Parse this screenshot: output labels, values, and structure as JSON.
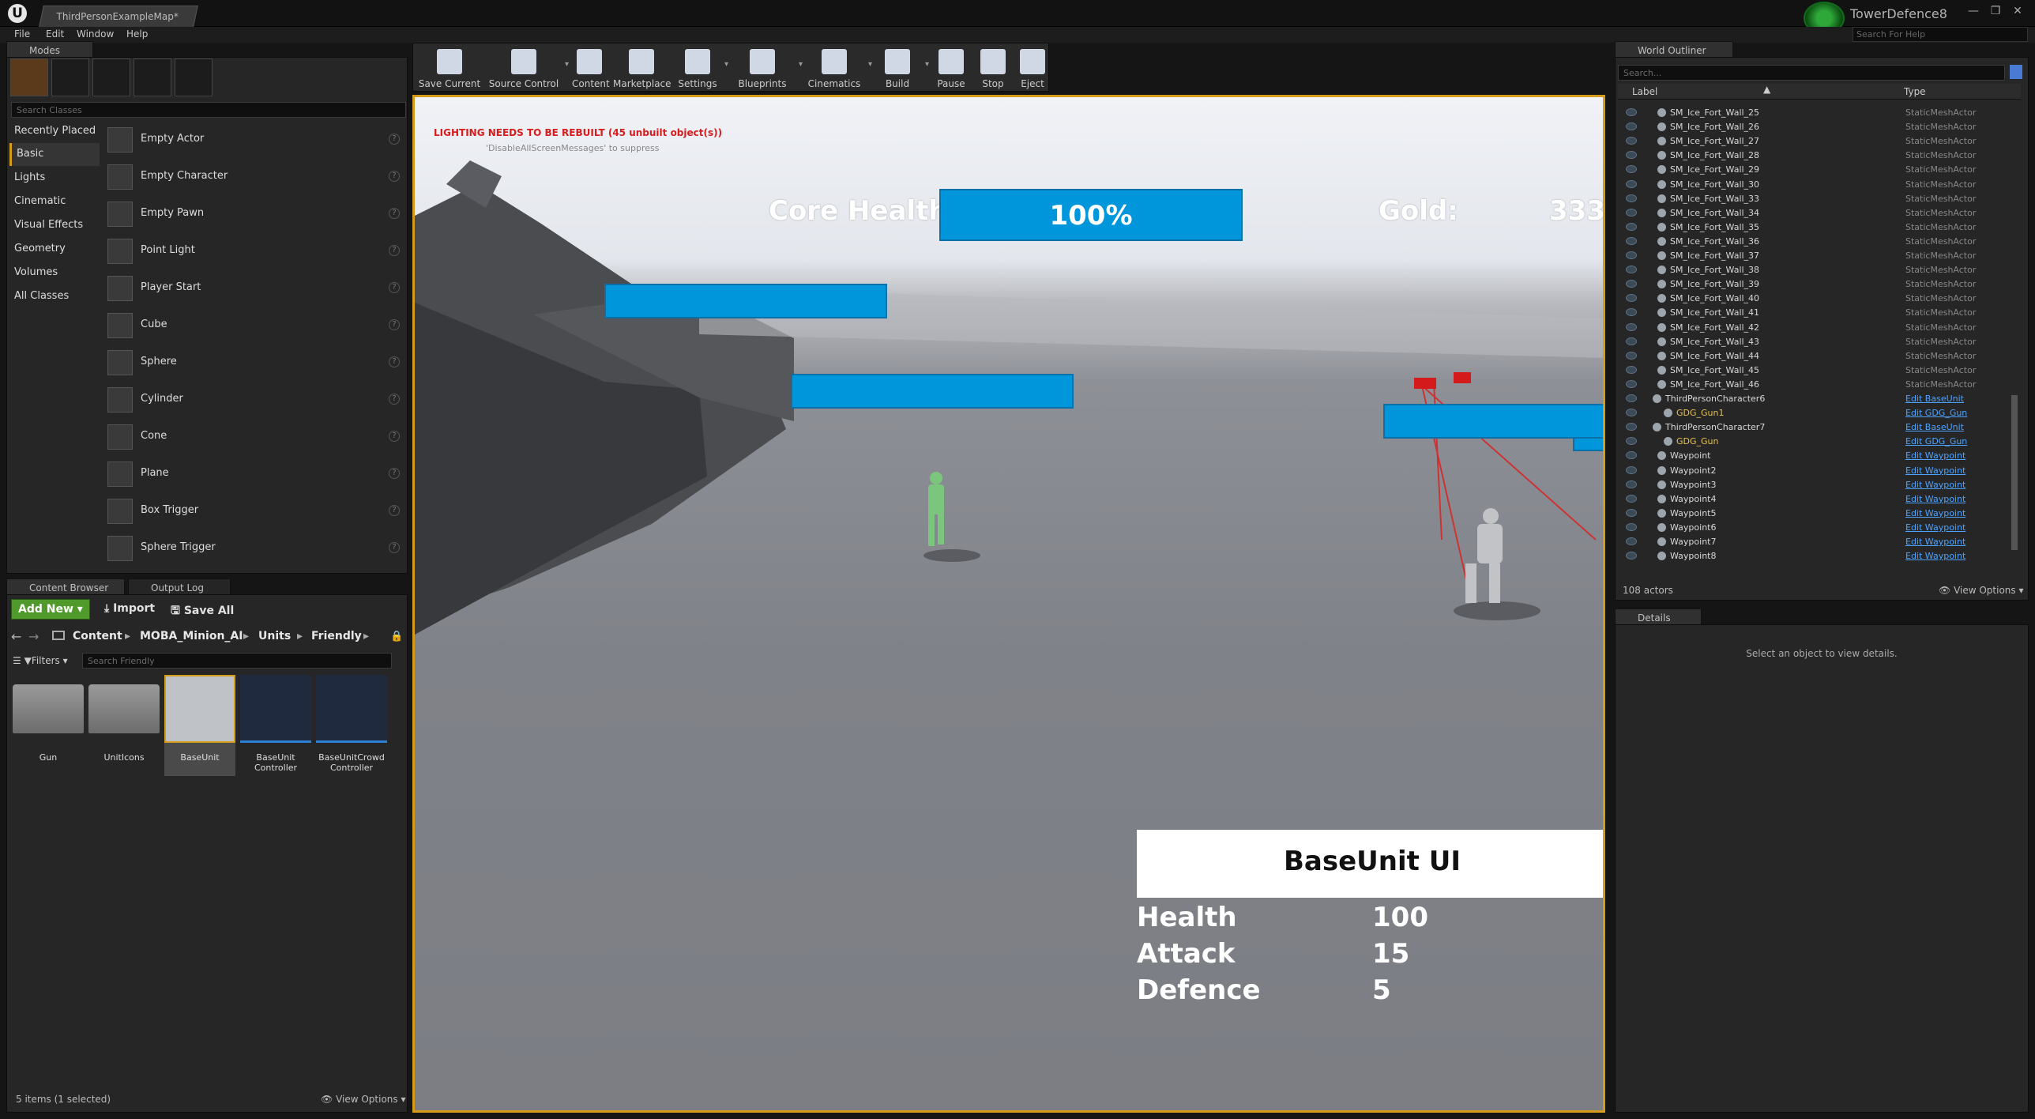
{
  "window": {
    "map_tab": "ThirdPersonExampleMap*",
    "project_name": "TowerDefence8",
    "help_placeholder": "Search For Help",
    "controls": [
      "—",
      "❐",
      "✕"
    ]
  },
  "menu": [
    "File",
    "Edit",
    "Window",
    "Help"
  ],
  "modes": {
    "tab": "Modes",
    "search_placeholder": "Search Classes",
    "categories": [
      "Recently Placed",
      "Basic",
      "Lights",
      "Cinematic",
      "Visual Effects",
      "Geometry",
      "Volumes",
      "All Classes"
    ],
    "selected_category": "Basic",
    "items": [
      "Empty Actor",
      "Empty Character",
      "Empty Pawn",
      "Point Light",
      "Player Start",
      "Cube",
      "Sphere",
      "Cylinder",
      "Cone",
      "Plane",
      "Box Trigger",
      "Sphere Trigger"
    ]
  },
  "content_browser": {
    "tabs": [
      "Content Browser",
      "Output Log"
    ],
    "add_new": "Add New",
    "import": "Import",
    "save_all": "Save All",
    "breadcrumb": [
      "Content",
      "MOBA_Minion_AI",
      "Units",
      "Friendly"
    ],
    "filters": "Filters",
    "search_placeholder": "Search Friendly",
    "assets": [
      {
        "name": "Gun",
        "kind": "folder"
      },
      {
        "name": "UnitIcons",
        "kind": "folder"
      },
      {
        "name": "BaseUnit",
        "kind": "mesh"
      },
      {
        "name": "BaseUnit Controller",
        "kind": "controller"
      },
      {
        "name": "BaseUnitCrowd Controller",
        "kind": "controller"
      }
    ],
    "status": "5 items (1 selected)",
    "view_options": "View Options"
  },
  "toolbar": [
    "Save Current",
    "Source Control",
    "Content",
    "Marketplace",
    "Settings",
    "Blueprints",
    "Cinematics",
    "Build",
    "Pause",
    "Stop",
    "Eject"
  ],
  "viewport": {
    "lighting_warning": "LIGHTING NEEDS TO BE REBUILT (45 unbuilt object(s))",
    "lighting_hint": "'DisableAllScreenMessages' to suppress",
    "core_health_label": "Core Health:",
    "core_health_value": "100%",
    "core_health_fraction": 1.0,
    "gold_label": "Gold:",
    "gold_value": "333",
    "unit_ui_title": "BaseUnit UI",
    "stats": [
      {
        "label": "Health",
        "value": "100"
      },
      {
        "label": "Attack",
        "value": "15"
      },
      {
        "label": "Defence",
        "value": "5"
      }
    ],
    "bar_color": "#0096dc",
    "accent_border": "#d59b1b"
  },
  "outliner": {
    "tab": "World Outliner",
    "search_placeholder": "Search...",
    "col_label": "Label",
    "col_type": "Type",
    "rows": [
      {
        "label": "SM_Ice_Fort_Wall_25",
        "type": "StaticMeshActor",
        "link": false,
        "gold": false,
        "indent": 1
      },
      {
        "label": "SM_Ice_Fort_Wall_26",
        "type": "StaticMeshActor",
        "link": false,
        "gold": false,
        "indent": 1
      },
      {
        "label": "SM_Ice_Fort_Wall_27",
        "type": "StaticMeshActor",
        "link": false,
        "gold": false,
        "indent": 1
      },
      {
        "label": "SM_Ice_Fort_Wall_28",
        "type": "StaticMeshActor",
        "link": false,
        "gold": false,
        "indent": 1
      },
      {
        "label": "SM_Ice_Fort_Wall_29",
        "type": "StaticMeshActor",
        "link": false,
        "gold": false,
        "indent": 1
      },
      {
        "label": "SM_Ice_Fort_Wall_30",
        "type": "StaticMeshActor",
        "link": false,
        "gold": false,
        "indent": 1
      },
      {
        "label": "SM_Ice_Fort_Wall_33",
        "type": "StaticMeshActor",
        "link": false,
        "gold": false,
        "indent": 1
      },
      {
        "label": "SM_Ice_Fort_Wall_34",
        "type": "StaticMeshActor",
        "link": false,
        "gold": false,
        "indent": 1
      },
      {
        "label": "SM_Ice_Fort_Wall_35",
        "type": "StaticMeshActor",
        "link": false,
        "gold": false,
        "indent": 1
      },
      {
        "label": "SM_Ice_Fort_Wall_36",
        "type": "StaticMeshActor",
        "link": false,
        "gold": false,
        "indent": 1
      },
      {
        "label": "SM_Ice_Fort_Wall_37",
        "type": "StaticMeshActor",
        "link": false,
        "gold": false,
        "indent": 1
      },
      {
        "label": "SM_Ice_Fort_Wall_38",
        "type": "StaticMeshActor",
        "link": false,
        "gold": false,
        "indent": 1
      },
      {
        "label": "SM_Ice_Fort_Wall_39",
        "type": "StaticMeshActor",
        "link": false,
        "gold": false,
        "indent": 1
      },
      {
        "label": "SM_Ice_Fort_Wall_40",
        "type": "StaticMeshActor",
        "link": false,
        "gold": false,
        "indent": 1
      },
      {
        "label": "SM_Ice_Fort_Wall_41",
        "type": "StaticMeshActor",
        "link": false,
        "gold": false,
        "indent": 1
      },
      {
        "label": "SM_Ice_Fort_Wall_42",
        "type": "StaticMeshActor",
        "link": false,
        "gold": false,
        "indent": 1
      },
      {
        "label": "SM_Ice_Fort_Wall_43",
        "type": "StaticMeshActor",
        "link": false,
        "gold": false,
        "indent": 1
      },
      {
        "label": "SM_Ice_Fort_Wall_44",
        "type": "StaticMeshActor",
        "link": false,
        "gold": false,
        "indent": 1
      },
      {
        "label": "SM_Ice_Fort_Wall_45",
        "type": "StaticMeshActor",
        "link": false,
        "gold": false,
        "indent": 1
      },
      {
        "label": "SM_Ice_Fort_Wall_46",
        "type": "StaticMeshActor",
        "link": false,
        "gold": false,
        "indent": 1
      },
      {
        "label": "ThirdPersonCharacter6",
        "type": "Edit BaseUnit",
        "link": true,
        "gold": false,
        "indent": 0
      },
      {
        "label": "GDG_Gun1",
        "type": "Edit GDG_Gun",
        "link": true,
        "gold": true,
        "indent": 2
      },
      {
        "label": "ThirdPersonCharacter7",
        "type": "Edit BaseUnit",
        "link": true,
        "gold": false,
        "indent": 0
      },
      {
        "label": "GDG_Gun",
        "type": "Edit GDG_Gun",
        "link": true,
        "gold": true,
        "indent": 2
      },
      {
        "label": "Waypoint",
        "type": "Edit Waypoint",
        "link": true,
        "gold": false,
        "indent": 1
      },
      {
        "label": "Waypoint2",
        "type": "Edit Waypoint",
        "link": true,
        "gold": false,
        "indent": 1
      },
      {
        "label": "Waypoint3",
        "type": "Edit Waypoint",
        "link": true,
        "gold": false,
        "indent": 1
      },
      {
        "label": "Waypoint4",
        "type": "Edit Waypoint",
        "link": true,
        "gold": false,
        "indent": 1
      },
      {
        "label": "Waypoint5",
        "type": "Edit Waypoint",
        "link": true,
        "gold": false,
        "indent": 1
      },
      {
        "label": "Waypoint6",
        "type": "Edit Waypoint",
        "link": true,
        "gold": false,
        "indent": 1
      },
      {
        "label": "Waypoint7",
        "type": "Edit Waypoint",
        "link": true,
        "gold": false,
        "indent": 1
      },
      {
        "label": "Waypoint8",
        "type": "Edit Waypoint",
        "link": true,
        "gold": false,
        "indent": 1
      }
    ],
    "actor_count": "108 actors",
    "view_options": "View Options"
  },
  "details": {
    "tab": "Details",
    "empty_message": "Select an object to view details."
  }
}
